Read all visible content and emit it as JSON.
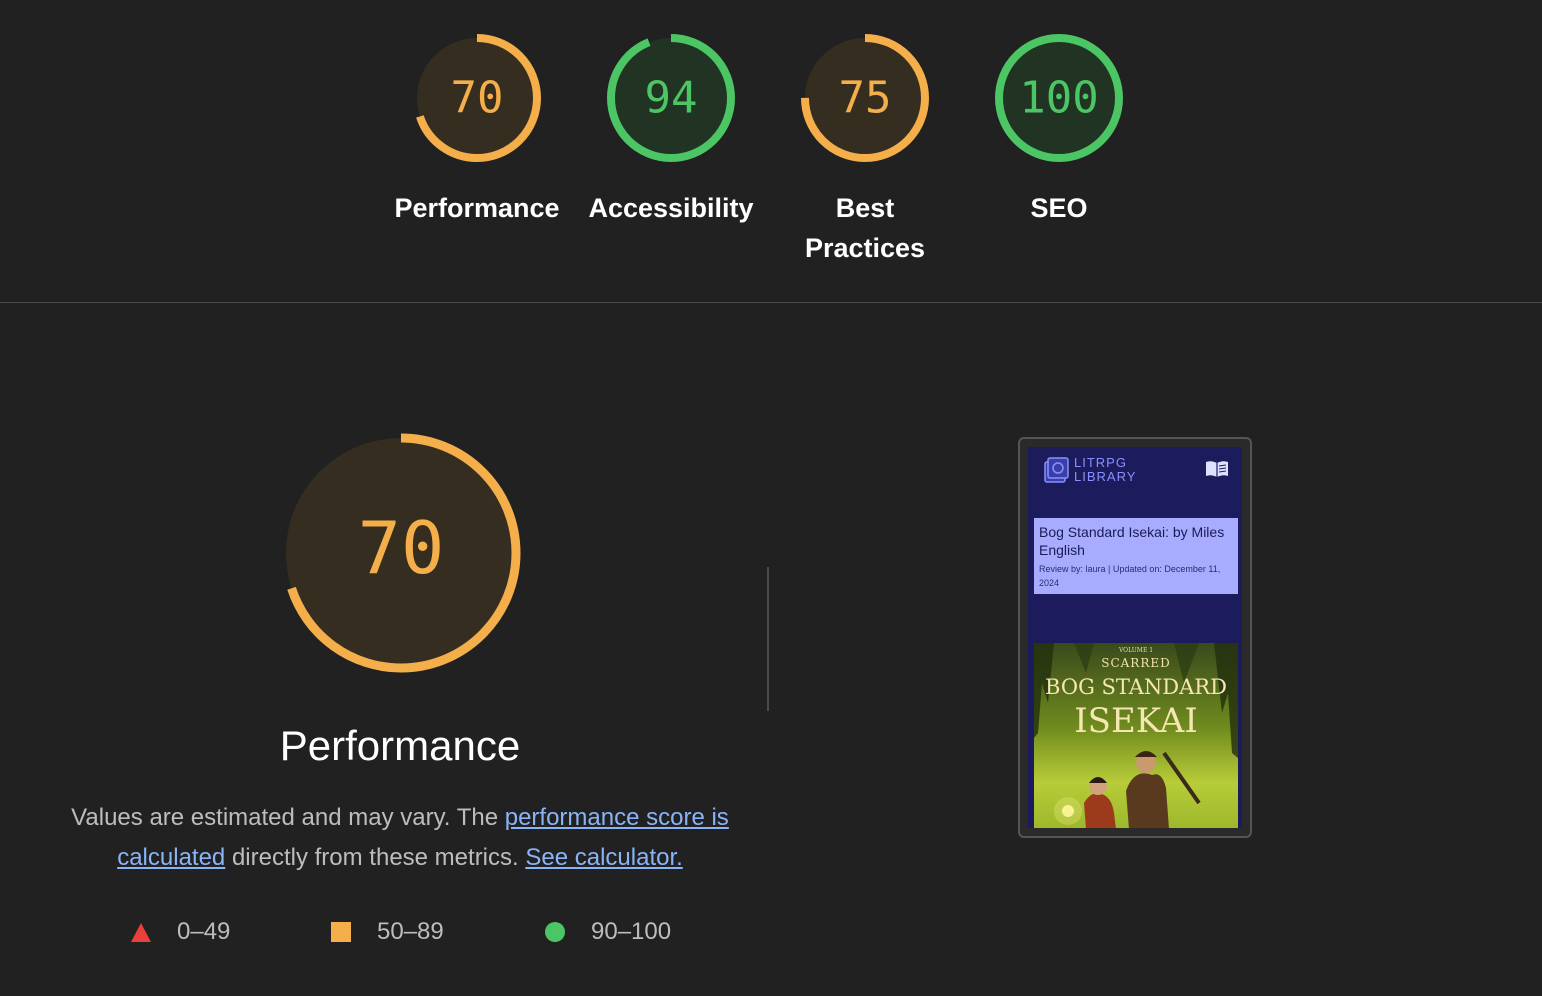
{
  "colors": {
    "background": "#212121",
    "average": "#f4ae4a",
    "average_fill": "#362d21",
    "pass": "#4cc565",
    "pass_fill": "#213424",
    "fail": "#eb3f3a",
    "link": "#8ab4f8"
  },
  "categories": [
    {
      "label": "Performance",
      "score": 70,
      "status": "average"
    },
    {
      "label": "Accessibility",
      "score": 94,
      "status": "pass"
    },
    {
      "label": "Best Practices",
      "score": 75,
      "status": "average"
    },
    {
      "label": "SEO",
      "score": 100,
      "status": "pass"
    }
  ],
  "performance": {
    "score": 70,
    "title": "Performance",
    "desc_prefix": "Values are estimated and may vary. The ",
    "desc_link1": "performance score is calculated",
    "desc_middle": " directly from these metrics. ",
    "desc_link2": "See calculator."
  },
  "legend": [
    {
      "shape": "triangle",
      "range": "0–49"
    },
    {
      "shape": "square",
      "range": "50–89"
    },
    {
      "shape": "circle",
      "range": "90–100"
    }
  ],
  "screenshot": {
    "site_name_line1": "LITRPG",
    "site_name_line2": "LIBRARY",
    "menu_icon": "book-menu-icon",
    "article_title": "Bog Standard Isekai: by Miles English",
    "article_meta": "Review by: laura | Updated on: December 11, 2024",
    "cover_volume": "VOLUME 1",
    "cover_series": "SCARRED",
    "cover_title_line1": "BOG STANDARD",
    "cover_title_line2": "ISEKAI"
  }
}
